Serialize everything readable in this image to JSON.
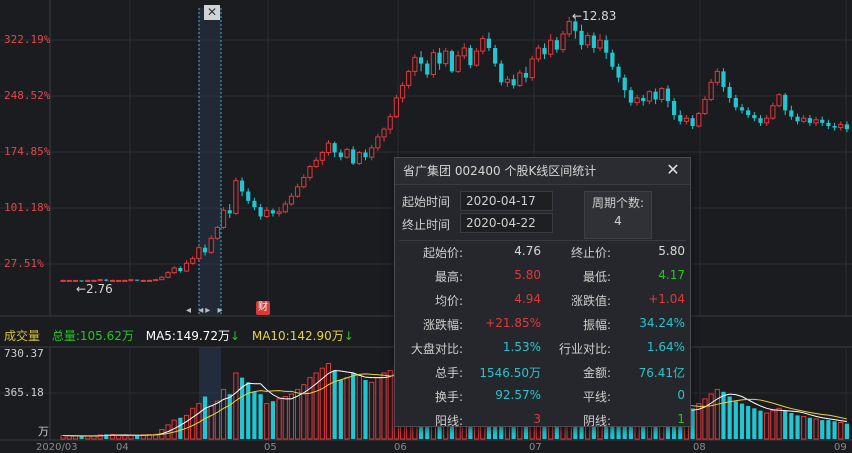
{
  "chart": {
    "price_axis": [
      "322.19%",
      "248.52%",
      "174.85%",
      "101.18%",
      "27.51%"
    ],
    "volume_axis": [
      "730.37",
      "365.18",
      "万"
    ],
    "months": [
      "2020/03",
      "04",
      "05",
      "06",
      "07",
      "08",
      "09"
    ],
    "peak_annotation": "←12.83",
    "low_annotation": "←2.76",
    "finance_badge": "财",
    "close_glyph": "✕",
    "arrows": [
      "◂",
      "◂▸",
      "▸"
    ],
    "colors": {
      "up": "#e0393b",
      "down": "#23c6d0",
      "ma5": "#ffffff",
      "ma10": "#e8d33c",
      "green": "#23c623"
    }
  },
  "chart_data": {
    "type": "candlestick",
    "title": "",
    "ylabel": "",
    "ylim_percent": [
      0,
      340
    ],
    "candles_percent": [
      [
        2,
        2,
        1,
        3
      ],
      [
        2,
        2,
        1,
        2
      ],
      [
        2,
        2,
        1,
        2
      ],
      [
        2,
        1,
        0,
        2
      ],
      [
        1,
        2,
        0,
        3
      ],
      [
        2,
        2,
        1,
        3
      ],
      [
        2,
        3,
        1,
        4
      ],
      [
        3,
        2,
        1,
        4
      ],
      [
        2,
        2,
        1,
        3
      ],
      [
        2,
        2,
        1,
        2
      ],
      [
        2,
        2,
        1,
        3
      ],
      [
        2,
        3,
        1,
        3
      ],
      [
        3,
        2,
        1,
        3
      ],
      [
        2,
        2,
        1,
        3
      ],
      [
        2,
        2,
        1,
        3
      ],
      [
        2,
        3,
        2,
        4
      ],
      [
        3,
        6,
        3,
        8
      ],
      [
        6,
        12,
        5,
        14
      ],
      [
        12,
        18,
        10,
        20
      ],
      [
        18,
        14,
        12,
        20
      ],
      [
        14,
        24,
        13,
        28
      ],
      [
        24,
        30,
        22,
        33
      ],
      [
        30,
        44,
        28,
        47
      ],
      [
        44,
        38,
        34,
        48
      ],
      [
        38,
        56,
        36,
        60
      ],
      [
        56,
        70,
        54,
        72
      ],
      [
        70,
        92,
        68,
        96
      ],
      [
        92,
        88,
        82,
        100
      ],
      [
        88,
        130,
        86,
        134
      ],
      [
        130,
        116,
        110,
        134
      ],
      [
        116,
        104,
        100,
        120
      ],
      [
        104,
        96,
        92,
        108
      ],
      [
        96,
        84,
        80,
        100
      ],
      [
        84,
        92,
        82,
        96
      ],
      [
        92,
        88,
        84,
        94
      ],
      [
        88,
        90,
        84,
        96
      ],
      [
        90,
        100,
        88,
        104
      ],
      [
        100,
        110,
        98,
        114
      ],
      [
        110,
        122,
        108,
        126
      ],
      [
        122,
        134,
        120,
        138
      ],
      [
        134,
        148,
        130,
        150
      ],
      [
        148,
        156,
        146,
        160
      ],
      [
        156,
        166,
        150,
        168
      ],
      [
        166,
        178,
        162,
        182
      ],
      [
        178,
        166,
        160,
        180
      ],
      [
        166,
        160,
        156,
        170
      ],
      [
        160,
        170,
        158,
        172
      ],
      [
        170,
        152,
        150,
        174
      ],
      [
        152,
        166,
        150,
        168
      ],
      [
        166,
        160,
        156,
        170
      ],
      [
        160,
        172,
        156,
        176
      ],
      [
        172,
        186,
        168,
        190
      ],
      [
        186,
        196,
        180,
        198
      ],
      [
        196,
        212,
        190,
        216
      ],
      [
        212,
        236,
        210,
        240
      ],
      [
        236,
        252,
        230,
        256
      ],
      [
        252,
        270,
        248,
        272
      ],
      [
        270,
        288,
        264,
        292
      ],
      [
        288,
        280,
        270,
        296
      ],
      [
        280,
        266,
        262,
        284
      ],
      [
        266,
        294,
        262,
        298
      ],
      [
        294,
        280,
        272,
        300
      ],
      [
        280,
        296,
        276,
        300
      ],
      [
        296,
        270,
        268,
        298
      ],
      [
        270,
        290,
        268,
        296
      ],
      [
        290,
        300,
        286,
        306
      ],
      [
        300,
        278,
        274,
        304
      ],
      [
        278,
        296,
        276,
        300
      ],
      [
        296,
        312,
        292,
        316
      ],
      [
        312,
        300,
        296,
        320
      ],
      [
        300,
        280,
        276,
        304
      ],
      [
        280,
        256,
        252,
        284
      ],
      [
        256,
        260,
        250,
        264
      ],
      [
        260,
        252,
        248,
        266
      ],
      [
        252,
        268,
        250,
        272
      ],
      [
        268,
        262,
        256,
        276
      ],
      [
        262,
        286,
        258,
        290
      ],
      [
        286,
        300,
        282,
        304
      ],
      [
        300,
        292,
        286,
        306
      ],
      [
        292,
        310,
        288,
        318
      ],
      [
        310,
        298,
        294,
        314
      ],
      [
        298,
        318,
        294,
        322
      ],
      [
        318,
        334,
        314,
        340
      ],
      [
        334,
        322,
        312,
        340
      ],
      [
        322,
        304,
        298,
        330
      ],
      [
        304,
        316,
        300,
        320
      ],
      [
        316,
        300,
        294,
        320
      ],
      [
        300,
        310,
        296,
        318
      ],
      [
        310,
        294,
        286,
        316
      ],
      [
        294,
        276,
        272,
        298
      ],
      [
        276,
        262,
        256,
        280
      ],
      [
        262,
        246,
        236,
        266
      ],
      [
        246,
        230,
        226,
        250
      ],
      [
        230,
        236,
        226,
        240
      ],
      [
        236,
        232,
        226,
        240
      ],
      [
        232,
        244,
        228,
        246
      ],
      [
        244,
        234,
        228,
        248
      ],
      [
        234,
        248,
        230,
        250
      ],
      [
        248,
        232,
        224,
        252
      ],
      [
        232,
        214,
        208,
        236
      ],
      [
        214,
        206,
        202,
        220
      ],
      [
        206,
        210,
        202,
        214
      ],
      [
        210,
        200,
        196,
        214
      ],
      [
        200,
        216,
        198,
        218
      ],
      [
        216,
        234,
        214,
        238
      ],
      [
        234,
        256,
        232,
        260
      ],
      [
        256,
        270,
        252,
        274
      ],
      [
        270,
        250,
        244,
        274
      ],
      [
        250,
        236,
        230,
        256
      ],
      [
        236,
        224,
        220,
        240
      ],
      [
        224,
        220,
        216,
        228
      ],
      [
        220,
        214,
        210,
        224
      ],
      [
        214,
        210,
        206,
        218
      ],
      [
        210,
        204,
        200,
        214
      ],
      [
        204,
        210,
        200,
        214
      ],
      [
        210,
        226,
        208,
        230
      ],
      [
        226,
        240,
        224,
        242
      ],
      [
        240,
        220,
        214,
        242
      ],
      [
        220,
        212,
        208,
        226
      ],
      [
        212,
        206,
        202,
        216
      ],
      [
        206,
        210,
        204,
        214
      ],
      [
        210,
        204,
        200,
        214
      ],
      [
        204,
        208,
        200,
        212
      ],
      [
        208,
        204,
        200,
        212
      ],
      [
        204,
        200,
        196,
        208
      ],
      [
        200,
        198,
        194,
        204
      ],
      [
        198,
        202,
        194,
        206
      ],
      [
        202,
        196,
        192,
        206
      ]
    ],
    "volumes_wan": [
      30,
      28,
      26,
      22,
      25,
      28,
      35,
      40,
      38,
      30,
      28,
      30,
      32,
      35,
      38,
      40,
      80,
      120,
      160,
      180,
      200,
      260,
      300,
      360,
      280,
      320,
      420,
      380,
      560,
      520,
      480,
      400,
      380,
      300,
      320,
      340,
      360,
      380,
      420,
      460,
      520,
      560,
      600,
      640,
      580,
      500,
      520,
      560,
      540,
      500,
      480,
      520,
      560,
      580,
      620,
      640,
      600,
      560,
      540,
      500,
      520,
      560,
      600,
      580,
      540,
      520,
      500,
      480,
      520,
      560,
      540,
      500,
      460,
      420,
      440,
      460,
      480,
      520,
      540,
      560,
      580,
      620,
      700,
      680,
      640,
      600,
      560,
      520,
      500,
      460,
      420,
      400,
      380,
      360,
      340,
      320,
      300,
      280,
      260,
      240,
      220,
      240,
      260,
      300,
      340,
      380,
      420,
      400,
      360,
      320,
      300,
      280,
      260,
      240,
      220,
      240,
      260,
      240,
      220,
      200,
      190,
      180,
      170,
      160,
      160,
      150,
      140,
      130
    ],
    "legend": {
      "label": "成交量",
      "total": "总量:105.62万",
      "ma5": "MA5:149.72万",
      "ma10": "MA10:142.90万"
    }
  },
  "dialog": {
    "title": "省广集团  002400  个股K线区间统计",
    "start_label": "起始时间",
    "start_value": "2020-04-17",
    "end_label": "终止时间",
    "end_value": "2020-04-22",
    "period_label": "周期个数:",
    "period_value": "4",
    "stats": [
      {
        "label": "起始价:",
        "value": "4.76",
        "color": "#d8d8d8",
        "label2": "终止价:",
        "value2": "5.80",
        "color2": "#d8d8d8"
      },
      {
        "label": "最高:",
        "value": "5.80",
        "color": "#e0393b",
        "label2": "最低:",
        "value2": "4.17",
        "color2": "#23c623"
      },
      {
        "label": "均价:",
        "value": "4.94",
        "color": "#e0393b",
        "label2": "涨跌值:",
        "value2": "+1.04",
        "color2": "#e0393b"
      },
      {
        "label": "涨跌幅:",
        "value": "+21.85%",
        "color": "#e0393b",
        "label2": "振幅:",
        "value2": "34.24%",
        "color2": "#23c6d0"
      },
      {
        "label": "大盘对比:",
        "value": "1.53%",
        "color": "#23c6d0",
        "label2": "行业对比:",
        "value2": "1.64%",
        "color2": "#23c6d0"
      },
      {
        "label": "总手:",
        "value": "1546.50万",
        "color": "#23c6d0",
        "label2": "金额:",
        "value2": "76.41亿",
        "color2": "#23c6d0"
      },
      {
        "label": "换手:",
        "value": "92.57%",
        "color": "#23c6d0",
        "label2": "平线:",
        "value2": "0",
        "color2": "#23c6d0"
      },
      {
        "label": "阳线:",
        "value": "3",
        "color": "#e0393b",
        "label2": "阴线:",
        "value2": "1",
        "color2": "#23c623"
      }
    ]
  }
}
